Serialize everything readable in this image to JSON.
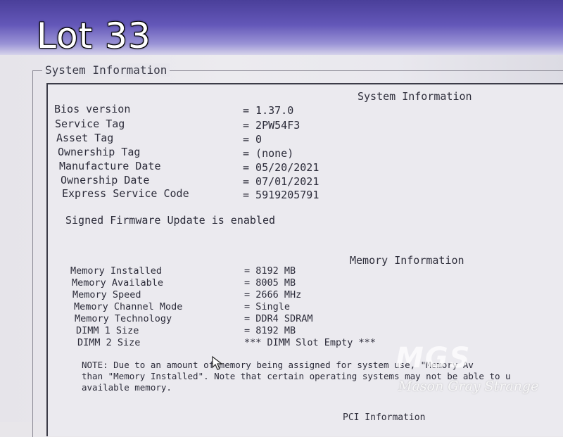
{
  "overlay": {
    "lot_label": "Lot 33"
  },
  "window": {
    "frame_title": "System Information"
  },
  "system_info": {
    "heading": "System Information",
    "rows": [
      {
        "label": "Bios version",
        "value": "= 1.37.0"
      },
      {
        "label": "Service Tag",
        "value": "= 2PW54F3"
      },
      {
        "label": "Asset Tag",
        "value": "= 0"
      },
      {
        "label": "Ownership Tag",
        "value": "= (none)"
      },
      {
        "label": "Manufacture Date",
        "value": "= 05/20/2021"
      },
      {
        "label": "Ownership Date",
        "value": "= 07/01/2021"
      },
      {
        "label": "Express Service Code",
        "value": "= 5919205791"
      }
    ],
    "firmware_status": "Signed Firmware Update is enabled"
  },
  "memory_info": {
    "heading": "Memory Information",
    "rows": [
      {
        "label": "Memory Installed",
        "value": "= 8192 MB"
      },
      {
        "label": "Memory Available",
        "value": "= 8005 MB"
      },
      {
        "label": "Memory Speed",
        "value": "= 2666 MHz"
      },
      {
        "label": "Memory Channel Mode",
        "value": "= Single"
      },
      {
        "label": "Memory Technology",
        "value": "= DDR4 SDRAM"
      },
      {
        "label": "DIMM 1 Size",
        "value": "= 8192 MB"
      },
      {
        "label": "DIMM 2 Size",
        "value": "*** DIMM Slot Empty ***"
      }
    ],
    "note_lines": [
      "NOTE: Due to an amount of memory being assigned for system use, \"Memory Av",
      "than \"Memory Installed\". Note that certain operating systems may not be able to u",
      "available memory."
    ]
  },
  "pci_info": {
    "heading": "PCI Information"
  },
  "watermark": {
    "logo": "MGS",
    "text": "Mason Gray Strange"
  },
  "icons": {
    "cursor": "mouse-pointer-icon"
  },
  "colors": {
    "bezel": "#5a4fb0",
    "screen": "#e8e6ec",
    "text": "#2c2c3a"
  }
}
